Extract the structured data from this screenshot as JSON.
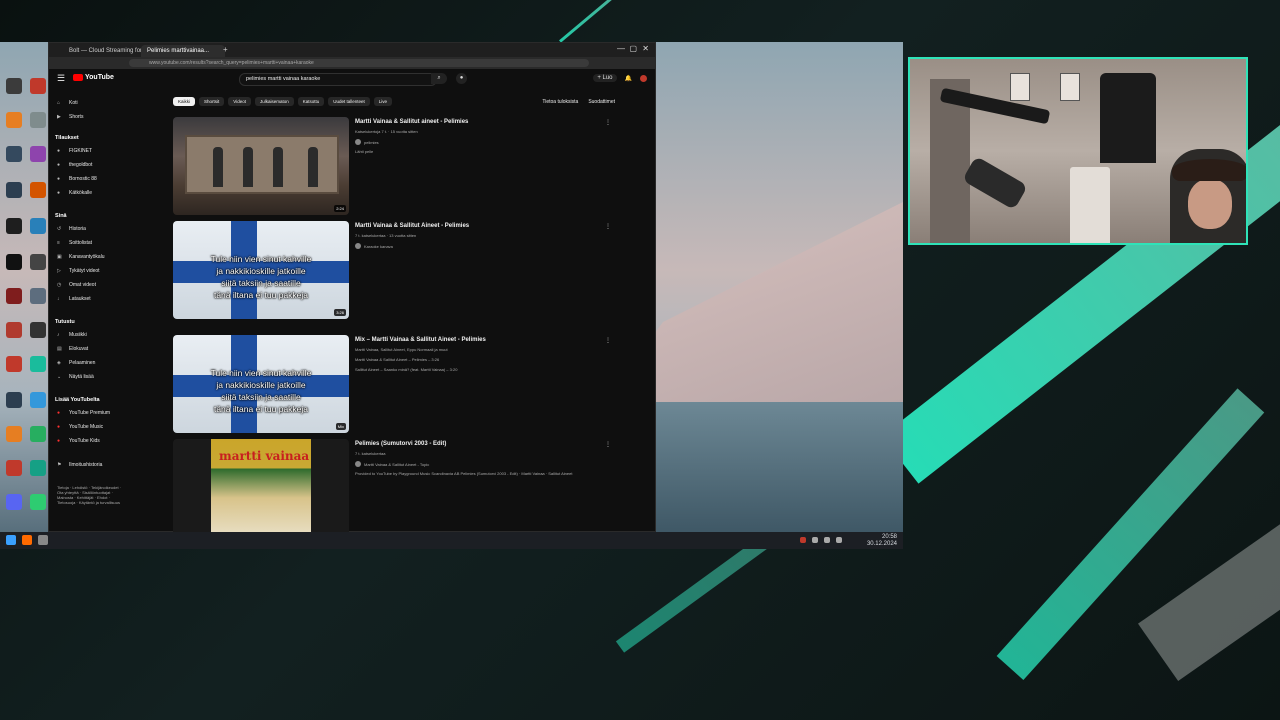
{
  "colors": {
    "accent": "#2fe3b8",
    "youtube_red": "#ff0000",
    "yt_bg": "#0f0f0f"
  },
  "browser": {
    "tabs": [
      {
        "label": "Bolt — Cloud Streaming for..."
      },
      {
        "label": "Pelimies marttivainaa..."
      }
    ],
    "new_tab": "+",
    "window_controls": [
      "—",
      "▢",
      "✕"
    ],
    "url": "www.youtube.com/results?search_query=pelimies+martti+vainaa+karaoke"
  },
  "youtube": {
    "logo_text": "YouTube",
    "search_value": "pelimies martti vainaa karaoke",
    "create_label": "+ Luo",
    "chips": [
      "Kaikki",
      "Shortsit",
      "Videot",
      "Julkaisematon",
      "Katsottu",
      "Uudet tallenteet",
      "Live"
    ],
    "filters": {
      "latest": "Tietoa tuloksista",
      "filter": "Suodattimet"
    },
    "sidebar": {
      "main": [
        {
          "icon": "home-icon",
          "label": "Koti"
        },
        {
          "icon": "shorts-icon",
          "label": "Shorts"
        }
      ],
      "subs_head": "Tilaukset",
      "subs": [
        {
          "label": "FIGKINET"
        },
        {
          "label": "thegoldbot"
        },
        {
          "label": "Bornostic 88"
        },
        {
          "label": "Kätkökalle"
        }
      ],
      "you_head": "Sinä",
      "you": [
        {
          "icon": "history-icon",
          "label": "Historia"
        },
        {
          "icon": "playlist-icon",
          "label": "Soittolistat"
        },
        {
          "icon": "channel-icon",
          "label": "Kanavantyökalu"
        },
        {
          "icon": "videos-icon",
          "label": "Tykätyt videot"
        },
        {
          "icon": "watch-later-icon",
          "label": "Omat videot"
        },
        {
          "icon": "download-icon",
          "label": "Lataukset"
        }
      ],
      "explore_head": "Tutustu",
      "explore": [
        {
          "icon": "music-icon",
          "label": "Musiikki"
        },
        {
          "icon": "movie-icon",
          "label": "Elokuvat"
        },
        {
          "icon": "gaming-icon",
          "label": "Pelaaminen"
        },
        {
          "icon": "news-icon",
          "label": "Näytä lisää"
        }
      ],
      "more_head": "Lisää YouTubelta",
      "more": [
        {
          "icon": "yt-premium-icon",
          "label": "YouTube Premium"
        },
        {
          "icon": "yt-music-icon",
          "label": "YouTube Music"
        },
        {
          "icon": "yt-kids-icon",
          "label": "YouTube Kids"
        }
      ],
      "flag_label": "Ilmoitushistoria",
      "footer": "Tietoja · Lehdistö · Tekijänoikeudet · Ota yhteyttä · Sisällöntuottajat · Mainosta · Kehittäjät · Ehdot · Tietosuoja · Käytäntö ja turvallisuus"
    },
    "results": [
      {
        "title": "Martti Vainaa & Sallitut aineet - Pelimies",
        "meta": "Katselukertoja 7 t. · 15 vuotta sitten",
        "channel": "pelimies",
        "desc": "Lähti pelle",
        "duration": "2:24",
        "thumb": "concert"
      },
      {
        "title": "Martti Vainaa & Sallitut Aineet - Pelimies",
        "meta": "7 t. katselukertaa · 13 vuotta sitten",
        "channel": "Karaoke kanava",
        "desc": "",
        "duration": "3:26",
        "thumb": "flag",
        "lyrics": [
          "Tule niin vien sinut kahville",
          "ja nakkikioskille jatkoille",
          "siitä taksiin ja saatille",
          "tänä iltana ei tuu pakkeja"
        ]
      },
      {
        "title": "Mix – Martti Vainaa & Sallitut Aineet - Pelimies",
        "meta": "Martti Vainaa, Sallitut Aineet, Eppu Normaali ja muut",
        "channel": "Martti Vainaa & Sallitut Aineet – Pelimies – 3:26",
        "desc": "Sallitut Aineet – Saanko minä? (feat. Martti Vainaa) – 3:20",
        "duration": "Mix",
        "thumb": "flag",
        "lyrics": [
          "Tule niin vien sinut kahville",
          "ja nakkikioskille jatkoille",
          "siitä taksiin ja saatille",
          "tänä iltana ei tuu pakkeja"
        ]
      },
      {
        "title": "Pelimies (Sumutorvi 2003 - Edit)",
        "meta": "7 t. katselukertaa",
        "channel": "Martti Vainaa & Sallitut Aineet - Topic",
        "desc": "Provided to YouTube by Playground Music Scandinavia AB Pelimies (Sumutorvi 2003 - Edit) · Martti Vainaa · Sallitut Aineet",
        "duration": "",
        "thumb": "poster",
        "poster_title": "martti vainaa"
      }
    ]
  },
  "taskbar": {
    "time": "20:58",
    "date": "30.12.2024"
  }
}
